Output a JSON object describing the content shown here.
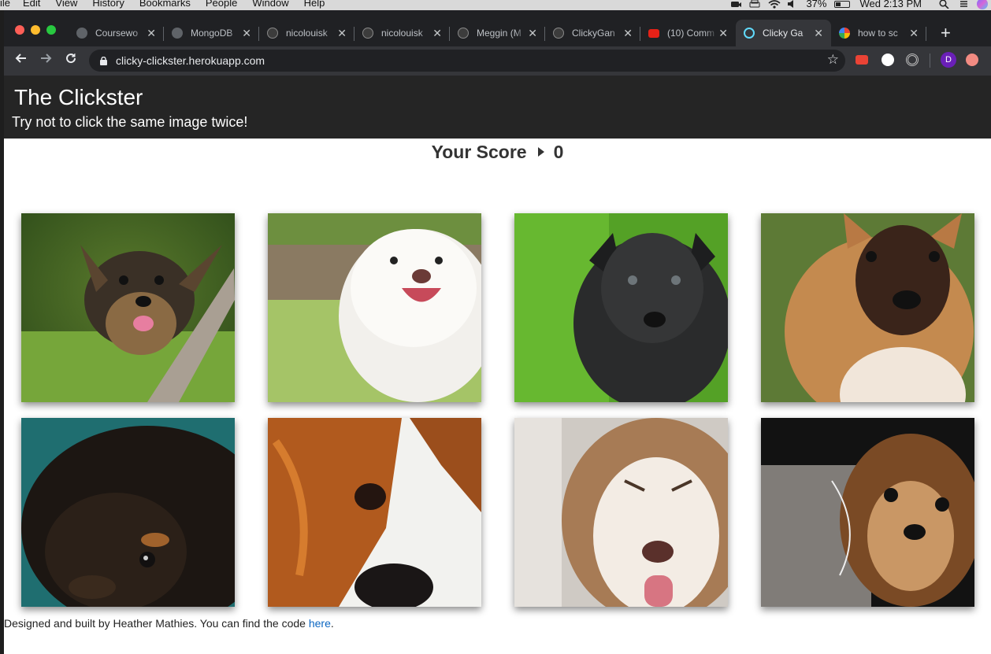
{
  "menubar": {
    "items": [
      "ile",
      "Edit",
      "View",
      "History",
      "Bookmarks",
      "People",
      "Window",
      "Help"
    ],
    "battery": "37%",
    "clock": "Wed 2:13 PM"
  },
  "tabs": [
    {
      "title": "Coursewo",
      "icon": "globe-icon",
      "color": "#5f6368"
    },
    {
      "title": "MongoDB",
      "icon": "globe-icon",
      "color": "#5f6368"
    },
    {
      "title": "nicolouisk",
      "icon": "github-icon",
      "color": "#3c3c3c"
    },
    {
      "title": "nicolouisk",
      "icon": "github-icon",
      "color": "#3c3c3c"
    },
    {
      "title": "Meggin (M",
      "icon": "github-icon",
      "color": "#3c3c3c"
    },
    {
      "title": "ClickyGan",
      "icon": "github-icon",
      "color": "#3c3c3c"
    },
    {
      "title": "(10) Comm",
      "icon": "youtube-icon",
      "color": "#e62117"
    },
    {
      "title": "Clicky Ga",
      "icon": "react-icon",
      "color": "#61dafb",
      "active": true
    },
    {
      "title": "how to sc",
      "icon": "google-icon",
      "color": "#4285f4"
    }
  ],
  "address_bar": {
    "url": "clicky-clickster.herokuapp.com"
  },
  "profile_initial": "D",
  "header": {
    "brand": "The Clickster",
    "tagline": "Try not to click the same image twice!"
  },
  "score": {
    "label": "Your Score",
    "value": "0"
  },
  "cards": [
    {
      "name": "yorkie-puppy-image"
    },
    {
      "name": "white-fluffy-puppy-image"
    },
    {
      "name": "black-puppy-image"
    },
    {
      "name": "brown-puppy-image"
    },
    {
      "name": "black-tan-dog-image"
    },
    {
      "name": "spaniel-closeup-image"
    },
    {
      "name": "husky-puppy-image"
    },
    {
      "name": "chihuahua-image"
    }
  ],
  "footer": {
    "text": "Designed and built by Heather Mathies. You can find the code ",
    "link": "here",
    "end": "."
  }
}
